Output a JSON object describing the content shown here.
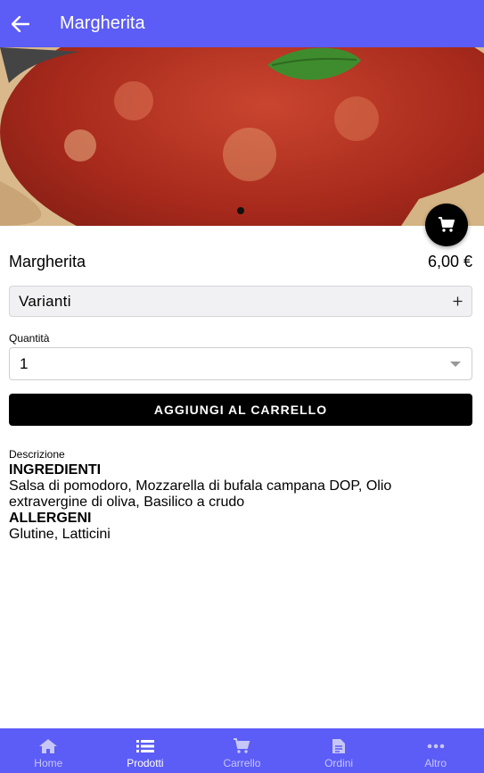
{
  "header": {
    "title": "Margherita"
  },
  "product": {
    "name": "Margherita",
    "price": "6,00 €",
    "variants_label": "Varianti",
    "quantity_label": "Quantità",
    "quantity_value": "1",
    "add_to_cart_label": "AGGIUNGI AL CARRELLO"
  },
  "description": {
    "label": "Descrizione",
    "ingredients_title": "INGREDIENTI",
    "ingredients_text": "Salsa di pomodoro, Mozzarella di bufala campana DOP, Olio extravergine di oliva, Basilico a crudo",
    "allergens_title": "ALLERGENI",
    "allergens_text": "Glutine, Latticini"
  },
  "bottom_nav": {
    "items": [
      {
        "label": "Home",
        "icon": "home-icon"
      },
      {
        "label": "Prodotti",
        "icon": "list-icon",
        "active": true
      },
      {
        "label": "Carrello",
        "icon": "cart-icon"
      },
      {
        "label": "Ordini",
        "icon": "document-icon"
      },
      {
        "label": "Altro",
        "icon": "more-icon"
      }
    ]
  },
  "colors": {
    "primary": "#5c5cf6",
    "button": "#000000"
  }
}
